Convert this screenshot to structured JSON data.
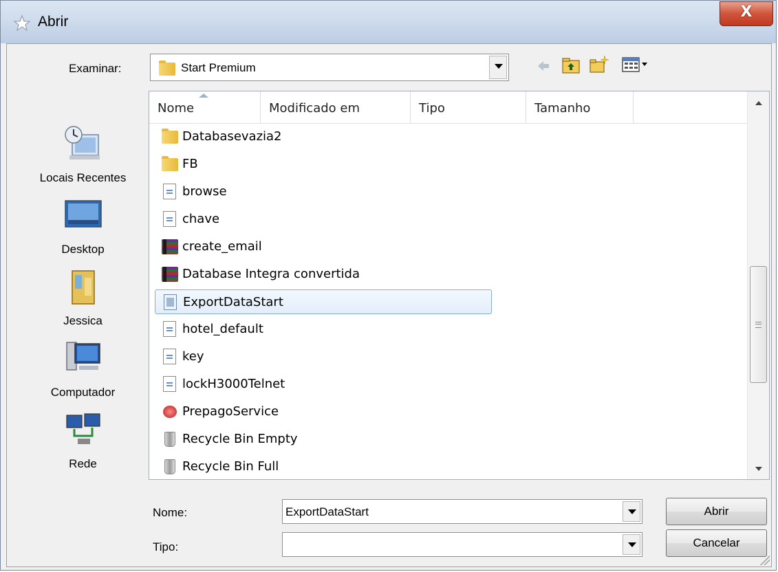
{
  "dialog": {
    "title": "Abrir",
    "close_glyph": "X",
    "look_in_label": "Examinar:",
    "look_in_value": "Start Premium",
    "file_name_label": "Nome:",
    "file_name_value": "ExportDataStart",
    "file_type_label": "Tipo:",
    "file_type_value": "",
    "open_button": "Abrir",
    "cancel_button": "Cancelar"
  },
  "toolbar": {
    "back_icon": "back-arrow-icon",
    "up_icon": "up-folder-icon",
    "new_folder_icon": "new-folder-icon",
    "view_icon": "view-menu-icon"
  },
  "places": [
    {
      "label": "Locais Recentes",
      "icon": "recent-places-icon"
    },
    {
      "label": "Desktop",
      "icon": "desktop-icon"
    },
    {
      "label": "Jessica",
      "icon": "user-folder-icon"
    },
    {
      "label": "Computador",
      "icon": "computer-icon"
    },
    {
      "label": "Rede",
      "icon": "network-icon"
    }
  ],
  "columns": [
    "Nome",
    "Modificado em",
    "Tipo",
    "Tamanho"
  ],
  "sorted_column": "Nome",
  "files": [
    {
      "name": "Databasevazia2",
      "icon": "folder-icon"
    },
    {
      "name": "FB",
      "icon": "folder-icon"
    },
    {
      "name": "browse",
      "icon": "document-icon"
    },
    {
      "name": "chave",
      "icon": "document-icon"
    },
    {
      "name": "create_email",
      "icon": "archive-icon"
    },
    {
      "name": "Database Integra convertida",
      "icon": "archive-icon"
    },
    {
      "name": "ExportDataStart",
      "icon": "export-file-icon",
      "selected": true
    },
    {
      "name": "hotel_default",
      "icon": "document-icon"
    },
    {
      "name": "key",
      "icon": "document-icon"
    },
    {
      "name": "lockH3000Telnet",
      "icon": "document-icon"
    },
    {
      "name": "PrepagoService",
      "icon": "service-icon"
    },
    {
      "name": "Recycle Bin Empty",
      "icon": "recycle-bin-empty-icon"
    },
    {
      "name": "Recycle Bin Full",
      "icon": "recycle-bin-full-icon"
    }
  ],
  "colors": {
    "title_gradient_top": "#dbe6f3",
    "close_button": "#c03a20",
    "selection_border": "#84acdd"
  }
}
